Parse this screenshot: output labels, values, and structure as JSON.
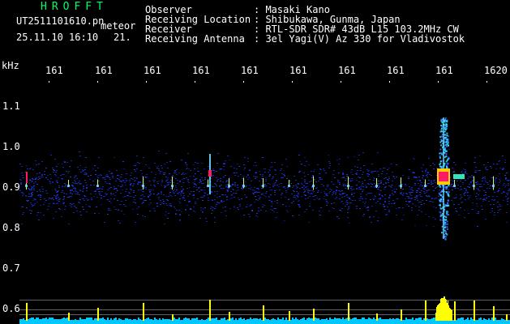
{
  "header": {
    "brand": "HROFFT",
    "file": "UT2511101610.pn",
    "mode": "meteor",
    "datetime": "25.11.10 16:10",
    "value": "21.",
    "info": [
      {
        "label": "Observer",
        "value": ": Masaki Kano"
      },
      {
        "label": "Receiving Location",
        "value": ": Shibukawa, Gunma, Japan"
      },
      {
        "label": "Receiver",
        "value": ": RTL-SDR SDR# 43dB L15 103.2MHz CW"
      },
      {
        "label": "Receiving Antenna",
        "value": ": 3el Yagi(V) Az 330 for Vladivostok"
      }
    ]
  },
  "axis": {
    "unit": "kHz",
    "x_ticks": [
      "161",
      "161",
      "161",
      "161",
      "161",
      "161",
      "161",
      "161",
      "161",
      "1620"
    ],
    "y_ticks": [
      "1.1",
      "1.0",
      "0.9",
      "0.8",
      "0.7",
      "0.6"
    ]
  },
  "colors": {
    "background": "#000000",
    "noise": "#1a2bd6",
    "header_green": "#00ff66",
    "spike": "#ffff00",
    "baseline": "#00c8ff",
    "hotspot": "#ff1a66"
  }
}
